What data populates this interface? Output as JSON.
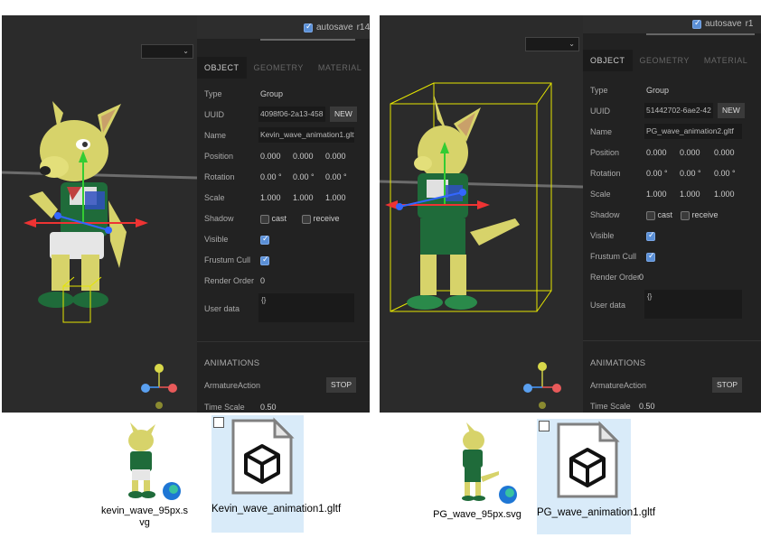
{
  "left": {
    "autosave_label": "autosave",
    "version": "r14",
    "tabs": [
      "OBJECT",
      "GEOMETRY",
      "MATERIAL"
    ],
    "type_label": "Type",
    "type_value": "Group",
    "uuid_label": "UUID",
    "uuid_value": "4098f06-2a13-458",
    "new_label": "NEW",
    "name_label": "Name",
    "name_value": "Kevin_wave_animation1.gltf",
    "position_label": "Position",
    "position": [
      "0.000",
      "0.000",
      "0.000"
    ],
    "rotation_label": "Rotation",
    "rotation": [
      "0.00 °",
      "0.00 °",
      "0.00 °"
    ],
    "scale_label": "Scale",
    "scale": [
      "1.000",
      "1.000",
      "1.000"
    ],
    "shadow_label": "Shadow",
    "cast_label": "cast",
    "receive_label": "receive",
    "visible_label": "Visible",
    "frustum_label": "Frustum Cull",
    "render_order_label": "Render Order",
    "render_order": "0",
    "user_data_label": "User data",
    "user_data": "{}",
    "animations_label": "ANIMATIONS",
    "action_label": "ArmatureAction",
    "stop_label": "STOP",
    "time_scale_label": "Time Scale",
    "time_scale": "0.50"
  },
  "right": {
    "autosave_label": "autosave",
    "version": "r1",
    "tabs": [
      "OBJECT",
      "GEOMETRY",
      "MATERIAL"
    ],
    "type_label": "Type",
    "type_value": "Group",
    "uuid_label": "UUID",
    "uuid_value": "51442702-6ae2-42",
    "new_label": "NEW",
    "name_label": "Name",
    "name_value": "PG_wave_animation2.gltf",
    "position_label": "Position",
    "position": [
      "0.000",
      "0.000",
      "0.000"
    ],
    "rotation_label": "Rotation",
    "rotation": [
      "0.00 °",
      "0.00 °",
      "0.00 °"
    ],
    "scale_label": "Scale",
    "scale": [
      "1.000",
      "1.000",
      "1.000"
    ],
    "shadow_label": "Shadow",
    "cast_label": "cast",
    "receive_label": "receive",
    "visible_label": "Visible",
    "frustum_label": "Frustum Cull",
    "render_order_label": "Render Order",
    "render_order": "0",
    "user_data_label": "User data",
    "user_data": "{}",
    "animations_label": "ANIMATIONS",
    "action_label": "ArmatureAction",
    "stop_label": "STOP",
    "time_scale_label": "Time Scale",
    "time_scale": "0.50"
  },
  "files": {
    "kevin_svg": "kevin_wave_95px.svg",
    "kevin_gltf": "Kevin_wave_animation1.gltf",
    "pg_svg": "PG_wave_95px.svg",
    "pg_gltf": "PG_wave_animation1.gltf"
  },
  "colors": {
    "accent": "#4a9eff",
    "panel": "#222222",
    "viewport": "#2b2b2b",
    "selection": "#d9ebf9"
  }
}
